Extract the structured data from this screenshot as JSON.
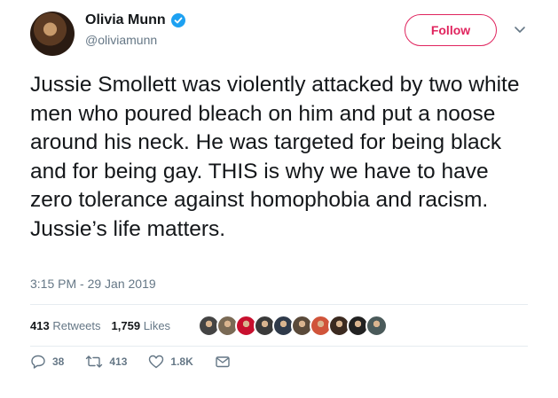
{
  "tweet": {
    "author_name": "Olivia Munn",
    "handle": "@oliviamunn",
    "follow_label": "Follow",
    "text": "Jussie Smollett was violently attacked by two white men who poured bleach on him and put a noose around his neck. He was targeted for being black and for being gay. THIS is why we have to have zero tolerance against homophobia and racism. Jussie’s life matters.",
    "timestamp": "3:15 PM - 29 Jan 2019"
  },
  "stats": {
    "retweets_count": "413",
    "retweets_label": "Retweets",
    "likes_count": "1,759",
    "likes_label": "Likes"
  },
  "actions": {
    "replies": "38",
    "retweets": "413",
    "likes": "1.8K"
  },
  "colors": {
    "follow_accent": "#e0245e",
    "verified": "#1da1f2",
    "muted_text": "#657786"
  },
  "liker_avatars": [
    "#444444",
    "#7a6a55",
    "#c8102e",
    "#3a3a3a",
    "#2f3a4a",
    "#5a4a3a",
    "#d0543a",
    "#3b2a20",
    "#222222",
    "#4a5a5a"
  ]
}
